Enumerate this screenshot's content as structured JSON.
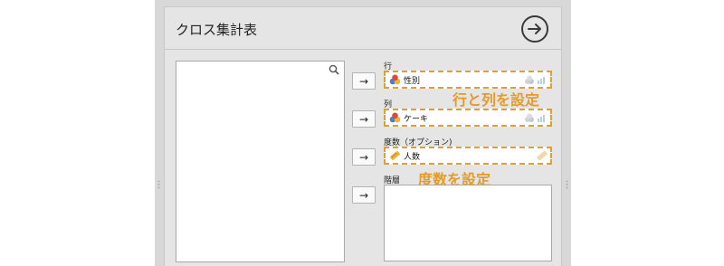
{
  "dialog": {
    "title": "クロス集計表",
    "go_icon": "circle-arrow-right-icon"
  },
  "variables_list": {
    "search_icon": "search-icon"
  },
  "arrow_label": "→",
  "slots": {
    "rows": {
      "label": "行",
      "variable": "性別"
    },
    "columns": {
      "label": "列",
      "variable": "ケーキ"
    },
    "counts": {
      "label": "度数（オプション)",
      "variable": "人数"
    },
    "layer": {
      "label": "階層"
    }
  },
  "annotations": {
    "rows_columns": "行と列を設定",
    "counts": "度数を設定"
  },
  "colors": {
    "accent": "#e39b2a",
    "panel": "#d8d8d8"
  }
}
